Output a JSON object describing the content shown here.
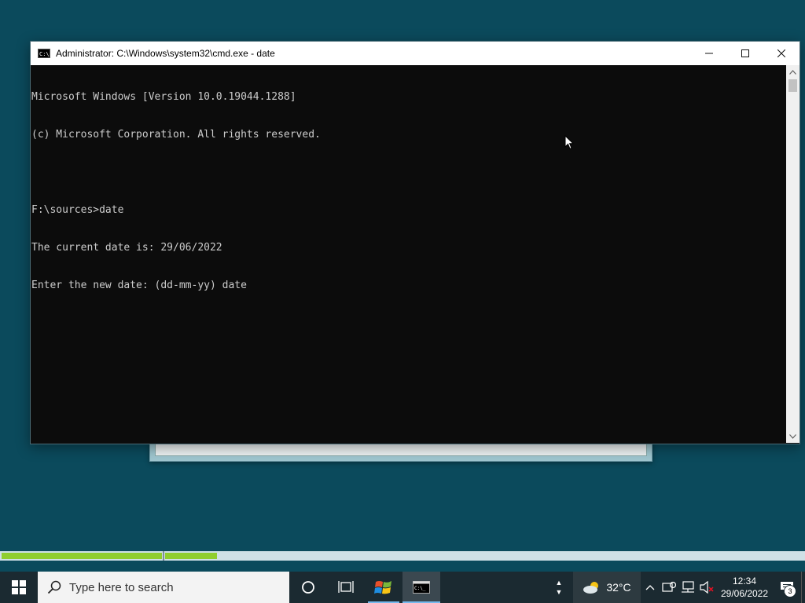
{
  "window": {
    "title": "Administrator: C:\\Windows\\system32\\cmd.exe - date",
    "minimize": "─",
    "maximize": "☐",
    "close": "✕"
  },
  "console": {
    "lines": [
      "Microsoft Windows [Version 10.0.19044.1288]",
      "(c) Microsoft Corporation. All rights reserved.",
      "",
      "F:\\sources>date",
      "The current date is: 29/06/2022",
      "Enter the new date: (dd-mm-yy) date"
    ]
  },
  "taskbar": {
    "search_placeholder": "Type here to search",
    "weather_temp": "32°C",
    "time": "12:34",
    "date": "29/06/2022",
    "notification_count": "3"
  },
  "progress": {
    "segment1_fill": 1.0,
    "segment2_fill": 0.08
  },
  "colors": {
    "desktop": "#0b4a5c",
    "console_bg": "#0c0c0c",
    "console_text": "#cccccc",
    "taskbar": "#1b2a31",
    "progress_fill": "#8fce2e"
  },
  "icons": {
    "start": "windows-logo-icon",
    "search": "search-icon",
    "cortana": "cortana-circle-icon",
    "task_view": "task-view-icon",
    "explorer": "windows-flag-icon",
    "cmd": "cmd-icon",
    "weather": "cloud-sun-icon"
  }
}
